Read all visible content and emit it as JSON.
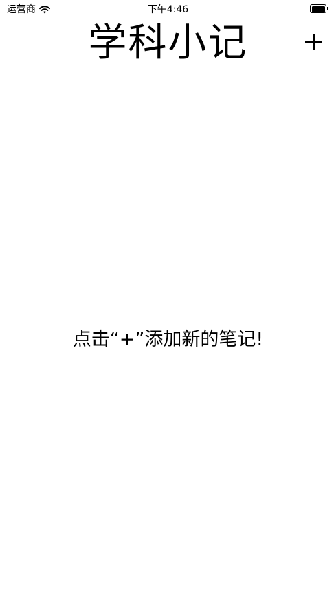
{
  "status_bar": {
    "carrier": "运营商",
    "time": "下午4:46"
  },
  "nav": {
    "title": "学科小记",
    "add_icon": "plus-icon"
  },
  "main": {
    "empty_hint": "点击“+”添加新的笔记!"
  }
}
